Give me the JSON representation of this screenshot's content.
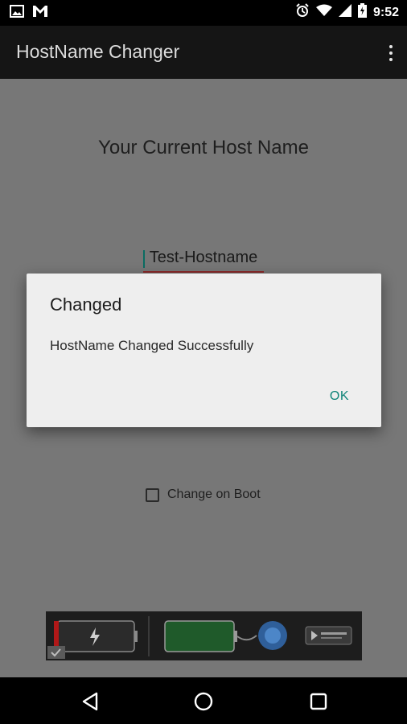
{
  "status_bar": {
    "time": "9:52",
    "left_icons": [
      "image-icon",
      "gmail-icon"
    ],
    "right_icons": [
      "alarm-icon",
      "wifi-icon",
      "signal-icon",
      "battery-charging-icon"
    ]
  },
  "app_bar": {
    "title": "HostName Changer",
    "menu_icon": "overflow-menu-icon"
  },
  "main": {
    "heading": "Your Current Host Name",
    "hostname_value": "Test-Hostname",
    "checkbox_label": "Change on Boot",
    "checkbox_checked": false
  },
  "dialog": {
    "title": "Changed",
    "message": "HostName Changed Successfully",
    "ok_label": "OK"
  },
  "nav_bar": {
    "buttons": [
      "back-icon",
      "home-icon",
      "recents-icon"
    ]
  },
  "colors": {
    "accent": "#0e8378",
    "scrim_background": "#777777",
    "dialog_background": "#eeeeee",
    "app_bar": "#151515"
  }
}
